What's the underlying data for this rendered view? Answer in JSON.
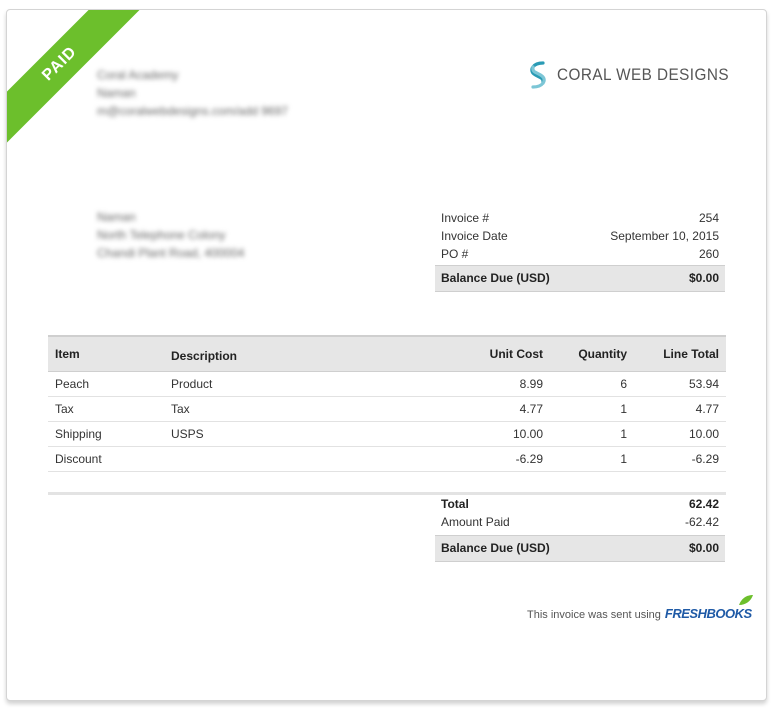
{
  "status_ribbon": "PAID",
  "sender": {
    "name": "Coral Academy",
    "line2": "Naman",
    "email": "m@coralwebdesigns.com/add 9697"
  },
  "company": {
    "logo_text": "CORAL WEB DESIGNS"
  },
  "recipient": {
    "name": "Naman",
    "line2": "North Telephone Colony",
    "line3": "Chandi Plant Road, 400004"
  },
  "invoice_meta": [
    {
      "label": "Invoice #",
      "value": "254"
    },
    {
      "label": "Invoice Date",
      "value": "September 10, 2015"
    },
    {
      "label": "PO #",
      "value": "260"
    }
  ],
  "balance_due_top": {
    "label": "Balance Due (USD)",
    "value": "$0.00"
  },
  "items_table": {
    "headers": [
      "Item",
      "Description",
      "Unit Cost",
      "Quantity",
      "Line Total"
    ],
    "rows": [
      [
        "Peach",
        "Product",
        "8.99",
        "6",
        "53.94"
      ],
      [
        "Tax",
        "Tax",
        "4.77",
        "1",
        "4.77"
      ],
      [
        "Shipping",
        "USPS",
        "10.00",
        "1",
        "10.00"
      ],
      [
        "Discount",
        "",
        "-6.29",
        "1",
        "-6.29"
      ]
    ]
  },
  "totals": [
    {
      "label": "Total",
      "value": "62.42"
    },
    {
      "label": "Amount Paid",
      "value": "-62.42"
    }
  ],
  "balance_due_bottom": {
    "label": "Balance Due (USD)",
    "value": "$0.00"
  },
  "footer": {
    "text": "This invoice was sent using",
    "brand": "FRESHBOOKS"
  },
  "colors": {
    "ribbon": "#6cbf2c",
    "logo_teal": "#2a9bb5",
    "freshbooks_blue": "#1f5aa6",
    "freshbooks_green": "#6cbf2c"
  }
}
